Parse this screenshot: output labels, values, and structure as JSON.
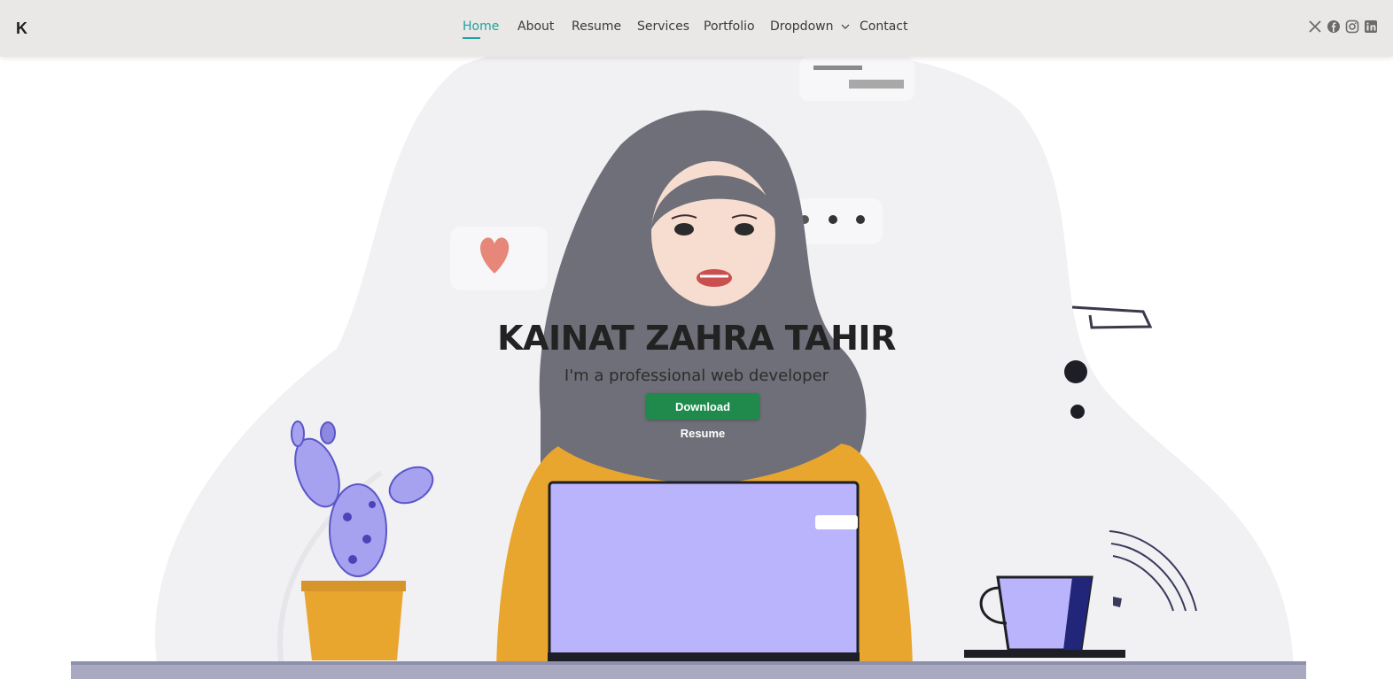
{
  "brand": {
    "logo_text": "K"
  },
  "nav": {
    "items": [
      {
        "label": "Home"
      },
      {
        "label": "About"
      },
      {
        "label": "Resume"
      },
      {
        "label": "Services"
      },
      {
        "label": "Portfolio"
      },
      {
        "label": "Dropdown"
      },
      {
        "label": "Contact"
      }
    ],
    "active_index": 0
  },
  "social": [
    "x-icon",
    "facebook-icon",
    "instagram-icon",
    "linkedin-icon"
  ],
  "hero": {
    "name": "KAINAT ZAHRA TAHIR",
    "tagline": "I'm a professional web developer",
    "cta_label": "Download Resume"
  },
  "colors": {
    "accent": "#1fa39b",
    "cta": "#1f8a4c",
    "header_bg": "#e9e8e6"
  }
}
